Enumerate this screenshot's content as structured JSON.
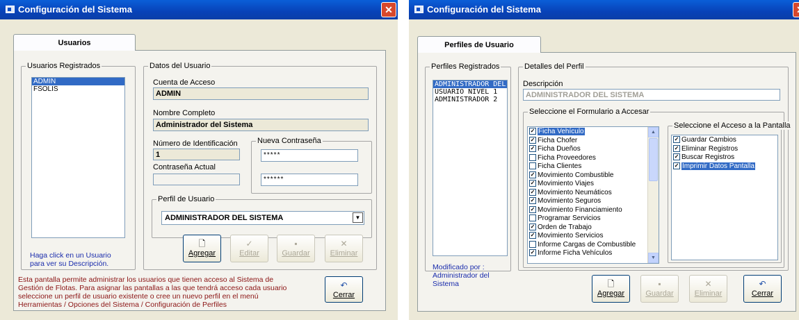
{
  "left": {
    "title": "Configuración del Sistema",
    "close_glyph": "✕",
    "tab": "Usuarios",
    "users_group": "Usuarios Registrados",
    "users": [
      "ADMIN",
      "FSOLIS"
    ],
    "selected_user_index": 0,
    "users_help": [
      "Haga click en un Usuario",
      "para ver su Descripción."
    ],
    "data_group": "Datos del Usuario",
    "account_label": "Cuenta de Acceso",
    "account_value": "ADMIN",
    "fullname_label": "Nombre Completo",
    "fullname_value": "Administrador del Sistema",
    "id_label": "Número de Identificación",
    "id_value": "1",
    "current_pwd_label": "Contraseña Actual",
    "new_pwd_group": "Nueva Contraseña",
    "new_pwd_value": "*****",
    "confirm_pwd_value": "******",
    "profile_group": "Perfil de Usuario",
    "profile_value": "ADMINISTRADOR DEL SISTEMA",
    "buttons": {
      "add": "Agregar",
      "edit": "Editar",
      "save": "Guardar",
      "delete": "Eliminar",
      "close": "Cerrar"
    },
    "note": [
      "Esta pantalla permite administrar los usuarios que tienen acceso al Sistema de",
      "Gestión de Flotas. Para asignar las pantallas a las que tendrá acceso cada usuario",
      "seleccione un perfil de usuario existente o cree un nuevo perfil en el menú",
      "Herramientas / Opciones del Sistema / Configuración de Perfiles"
    ]
  },
  "right": {
    "title": "Configuración del Sistema",
    "close_glyph": "✕",
    "tab": "Perfiles de Usuario",
    "profiles_group": "Perfiles Registrados",
    "profiles": [
      "ADMINISTRADOR DEL S",
      "USUARIO NIVEL 1",
      "ADMINISTRADOR 2"
    ],
    "selected_profile_index": 0,
    "modified_label": "Modificado por :",
    "modified_value": "Administrador del Sistema",
    "details_group": "Detalles del Perfil",
    "description_label": "Descripción",
    "description_value": "ADMINISTRADOR DEL SISTEMA",
    "forms_group": "Seleccione el Formulario a Accesar",
    "forms": [
      {
        "label": "Ficha Vehículo",
        "checked": true,
        "selected": true
      },
      {
        "label": "Ficha Chofer",
        "checked": true
      },
      {
        "label": "Ficha Dueños",
        "checked": true
      },
      {
        "label": "Ficha Proveedores",
        "checked": false
      },
      {
        "label": "Ficha Clientes",
        "checked": false
      },
      {
        "label": "Movimiento Combustible",
        "checked": true
      },
      {
        "label": "Movimiento Viajes",
        "checked": true
      },
      {
        "label": "Movimiento Neumáticos",
        "checked": true
      },
      {
        "label": "Movimiento Seguros",
        "checked": true
      },
      {
        "label": "Movimiento Financiamiento",
        "checked": true
      },
      {
        "label": "Programar Servicios",
        "checked": false
      },
      {
        "label": "Orden de Trabajo",
        "checked": true
      },
      {
        "label": "Movimiento Servicios",
        "checked": true
      },
      {
        "label": "Informe Cargas de Combustible",
        "checked": false
      },
      {
        "label": "Informe Ficha Vehículos",
        "checked": true
      }
    ],
    "access_group": "Seleccione el Acceso a la Pantalla",
    "access": [
      {
        "label": "Guardar Cambios",
        "checked": true
      },
      {
        "label": "Eliminar Registros",
        "checked": true
      },
      {
        "label": "Buscar Registros",
        "checked": true
      },
      {
        "label": "Imprimir Datos Pantalla",
        "checked": true,
        "selected": true
      }
    ],
    "buttons": {
      "add": "Agregar",
      "save": "Guardar",
      "delete": "Eliminar",
      "close": "Cerrar"
    }
  }
}
